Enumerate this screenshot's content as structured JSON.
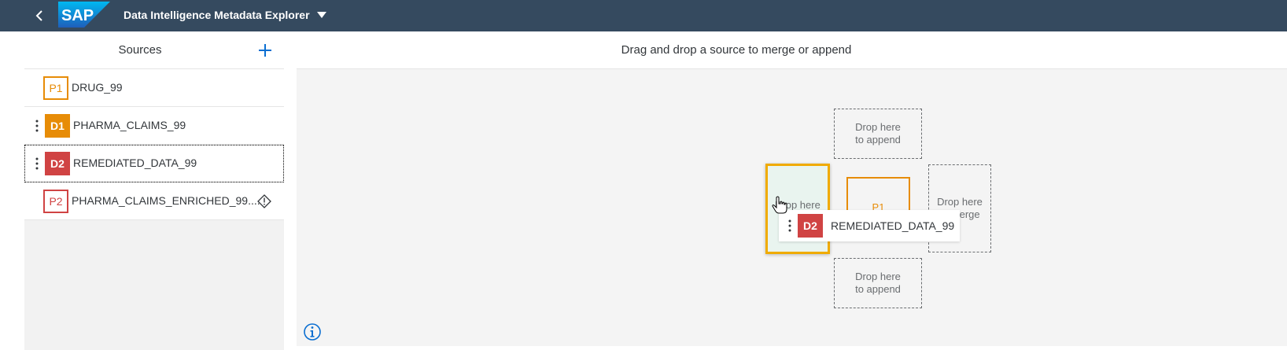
{
  "header": {
    "app_title": "Data Intelligence Metadata Explorer",
    "logo_text": "SAP",
    "background": "#354a5f"
  },
  "sources": {
    "title": "Sources",
    "add_icon": "plus-icon",
    "items": [
      {
        "badge": "P1",
        "name": "DRUG_99",
        "style": "outline-orange",
        "draggable": false,
        "selected": false
      },
      {
        "badge": "D1",
        "name": "PHARMA_CLAIMS_99",
        "style": "fill-orange",
        "draggable": true,
        "selected": false
      },
      {
        "badge": "D2",
        "name": "REMEDIATED_DATA_99",
        "style": "fill-red",
        "draggable": true,
        "selected": true
      },
      {
        "badge": "P2",
        "name": "PHARMA_CLAIMS_ENRICHED_99....",
        "style": "outline-red",
        "draggable": false,
        "selected": false,
        "warning_icon": "diamond-warning-icon"
      }
    ]
  },
  "canvas": {
    "instruction": "Drag and drop a source to merge or append",
    "drop_top": "Drop here\nto append",
    "drop_bottom": "Drop here\nto append",
    "drop_right": "Drop here\nto merge",
    "drop_left": "Drop here",
    "center_badge": "P1",
    "drag_item": {
      "badge": "D2",
      "name": "REMEDIATED_DATA_99"
    },
    "info_icon": "info-icon"
  },
  "colors": {
    "accent_orange": "#e78c07",
    "accent_red": "#d04343",
    "highlight": "#f0ab00",
    "link_blue": "#0a6ed1"
  }
}
